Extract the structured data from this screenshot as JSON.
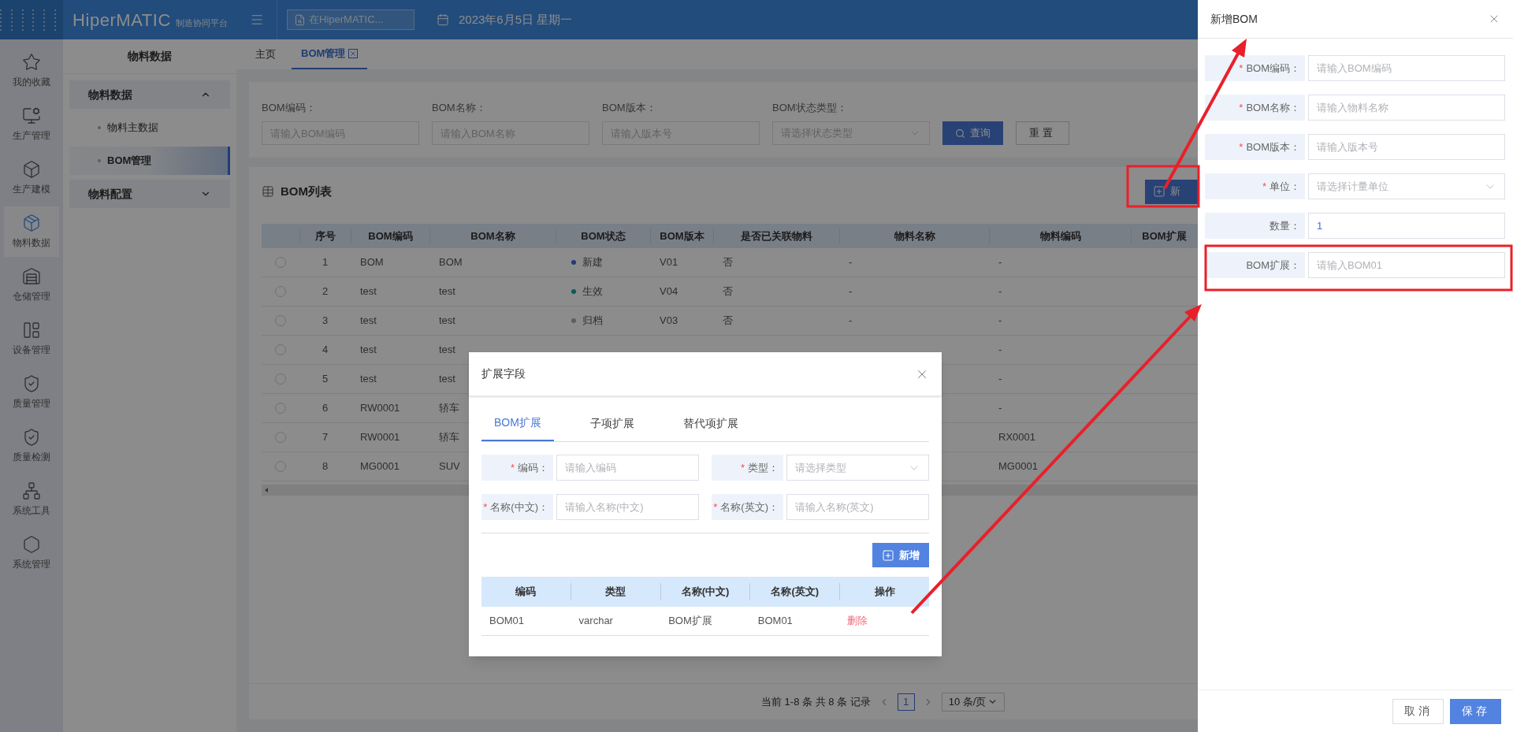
{
  "header": {
    "brand": "HiperMATIC",
    "brand_sub": "制造协同平台",
    "search": {
      "placeholder": "在HiperMATIC..."
    },
    "date": "2023年6月5日 星期一"
  },
  "rail": [
    {
      "label": "我的收藏",
      "selected": false
    },
    {
      "label": "生产管理",
      "selected": false
    },
    {
      "label": "生产建模",
      "selected": false
    },
    {
      "label": "物料数据",
      "selected": true
    },
    {
      "label": "仓储管理",
      "selected": false
    },
    {
      "label": "设备管理",
      "selected": false
    },
    {
      "label": "质量管理",
      "selected": false
    },
    {
      "label": "质量检测",
      "selected": false
    },
    {
      "label": "系统工具",
      "selected": false
    },
    {
      "label": "系统管理",
      "selected": false
    }
  ],
  "sidebar": {
    "title": "物料数据",
    "groups": [
      {
        "label": "物料数据",
        "expanded": true,
        "children": [
          {
            "label": "物料主数据",
            "selected": false
          },
          {
            "label": "BOM管理",
            "selected": true
          }
        ]
      },
      {
        "label": "物料配置",
        "expanded": false
      }
    ]
  },
  "tabs": [
    {
      "label": "主页",
      "selected": false,
      "closable": false
    },
    {
      "label": "BOM管理",
      "selected": true,
      "closable": true
    }
  ],
  "filters": [
    {
      "kind": "input",
      "label": "BOM编码：",
      "placeholder": "请输入BOM编码"
    },
    {
      "kind": "input",
      "label": "BOM名称：",
      "placeholder": "请输入BOM名称"
    },
    {
      "kind": "input",
      "label": "BOM版本：",
      "placeholder": "请输入版本号"
    },
    {
      "kind": "select",
      "label": "BOM状态类型：",
      "placeholder": "请选择状态类型"
    }
  ],
  "filter_buttons": {
    "search": "查询",
    "reset": "重置"
  },
  "list": {
    "title": "BOM列表",
    "add_button": "新",
    "columns": [
      "序号",
      "BOM编码",
      "BOM名称",
      "BOM状态",
      "BOM版本",
      "是否已关联物料",
      "物料名称",
      "物料编码",
      "BOM扩展"
    ],
    "rows": [
      {
        "selected": false,
        "seq": "1",
        "code": "BOM",
        "name": "BOM",
        "status": {
          "label": "新建",
          "color": "#203d77"
        },
        "version": "V01",
        "linked": "否",
        "material_name": "-",
        "material_code": "-"
      },
      {
        "selected": false,
        "seq": "2",
        "code": "test",
        "name": "test",
        "status": {
          "label": "生效",
          "color": "#0e5a55"
        },
        "version": "V04",
        "linked": "否",
        "material_name": "-",
        "material_code": "-"
      },
      {
        "selected": false,
        "seq": "3",
        "code": "test",
        "name": "test",
        "status": {
          "label": "归档",
          "color": "#5e5e5e"
        },
        "version": "V03",
        "linked": "否",
        "material_name": "-",
        "material_code": "-"
      },
      {
        "selected": false,
        "seq": "4",
        "code": "test",
        "name": "test",
        "material_code": "-"
      },
      {
        "selected": false,
        "seq": "5",
        "code": "test",
        "name": "test",
        "material_code": "-"
      },
      {
        "selected": false,
        "seq": "6",
        "code": "RW0001",
        "name": "轿车",
        "material_code": "-"
      },
      {
        "selected": false,
        "seq": "7",
        "code": "RW0001",
        "name": "轿车",
        "material_code": "RX0001"
      },
      {
        "selected": false,
        "seq": "8",
        "code": "MG0001",
        "name": "SUV",
        "material_code": "MG0001"
      }
    ]
  },
  "pagination": {
    "summary": "当前 1-8 条 共 8 条 记录",
    "pages": [
      {
        "label": "1",
        "selected": true
      }
    ],
    "page_size": "10 条/页"
  },
  "dialog": {
    "title": "扩展字段",
    "required_mark": "*",
    "tabs": [
      {
        "label": "BOM扩展",
        "selected": true
      },
      {
        "label": "子项扩展",
        "selected": false
      },
      {
        "label": "替代项扩展",
        "selected": false
      }
    ],
    "fields": [
      {
        "kind": "input",
        "required": true,
        "label": "编码：",
        "placeholder": "请输入编码"
      },
      {
        "kind": "select",
        "required": true,
        "label": "类型：",
        "placeholder": "请选择类型"
      },
      {
        "kind": "input",
        "required": true,
        "label": "名称(中文)：",
        "placeholder": "请输入名称(中文)"
      },
      {
        "kind": "input",
        "required": true,
        "label": "名称(英文)：",
        "placeholder": "请输入名称(英文)"
      }
    ],
    "add_button": "新增",
    "columns": [
      "编码",
      "类型",
      "名称(中文)",
      "名称(英文)",
      "操作"
    ],
    "rows": [
      {
        "cells": [
          "BOM01",
          "varchar",
          "BOM扩展",
          "BOM01"
        ],
        "action": "删除"
      }
    ]
  },
  "drawer": {
    "title": "新增BOM",
    "required_mark": "*",
    "fields": [
      {
        "kind": "input",
        "required": true,
        "label": "BOM编码：",
        "placeholder": "请输入BOM编码"
      },
      {
        "kind": "input",
        "required": true,
        "label": "BOM名称：",
        "placeholder": "请输入物料名称"
      },
      {
        "kind": "input",
        "required": true,
        "label": "BOM版本：",
        "placeholder": "请输入版本号"
      },
      {
        "kind": "select",
        "required": true,
        "label": "单位：",
        "placeholder": "请选择计量单位"
      },
      {
        "kind": "input",
        "required": false,
        "label": "数量：",
        "value": "1"
      },
      {
        "kind": "input",
        "required": false,
        "label": "BOM扩展：",
        "placeholder": "请输入BOM01"
      }
    ],
    "buttons": {
      "cancel": "取消",
      "save": "保存"
    }
  }
}
